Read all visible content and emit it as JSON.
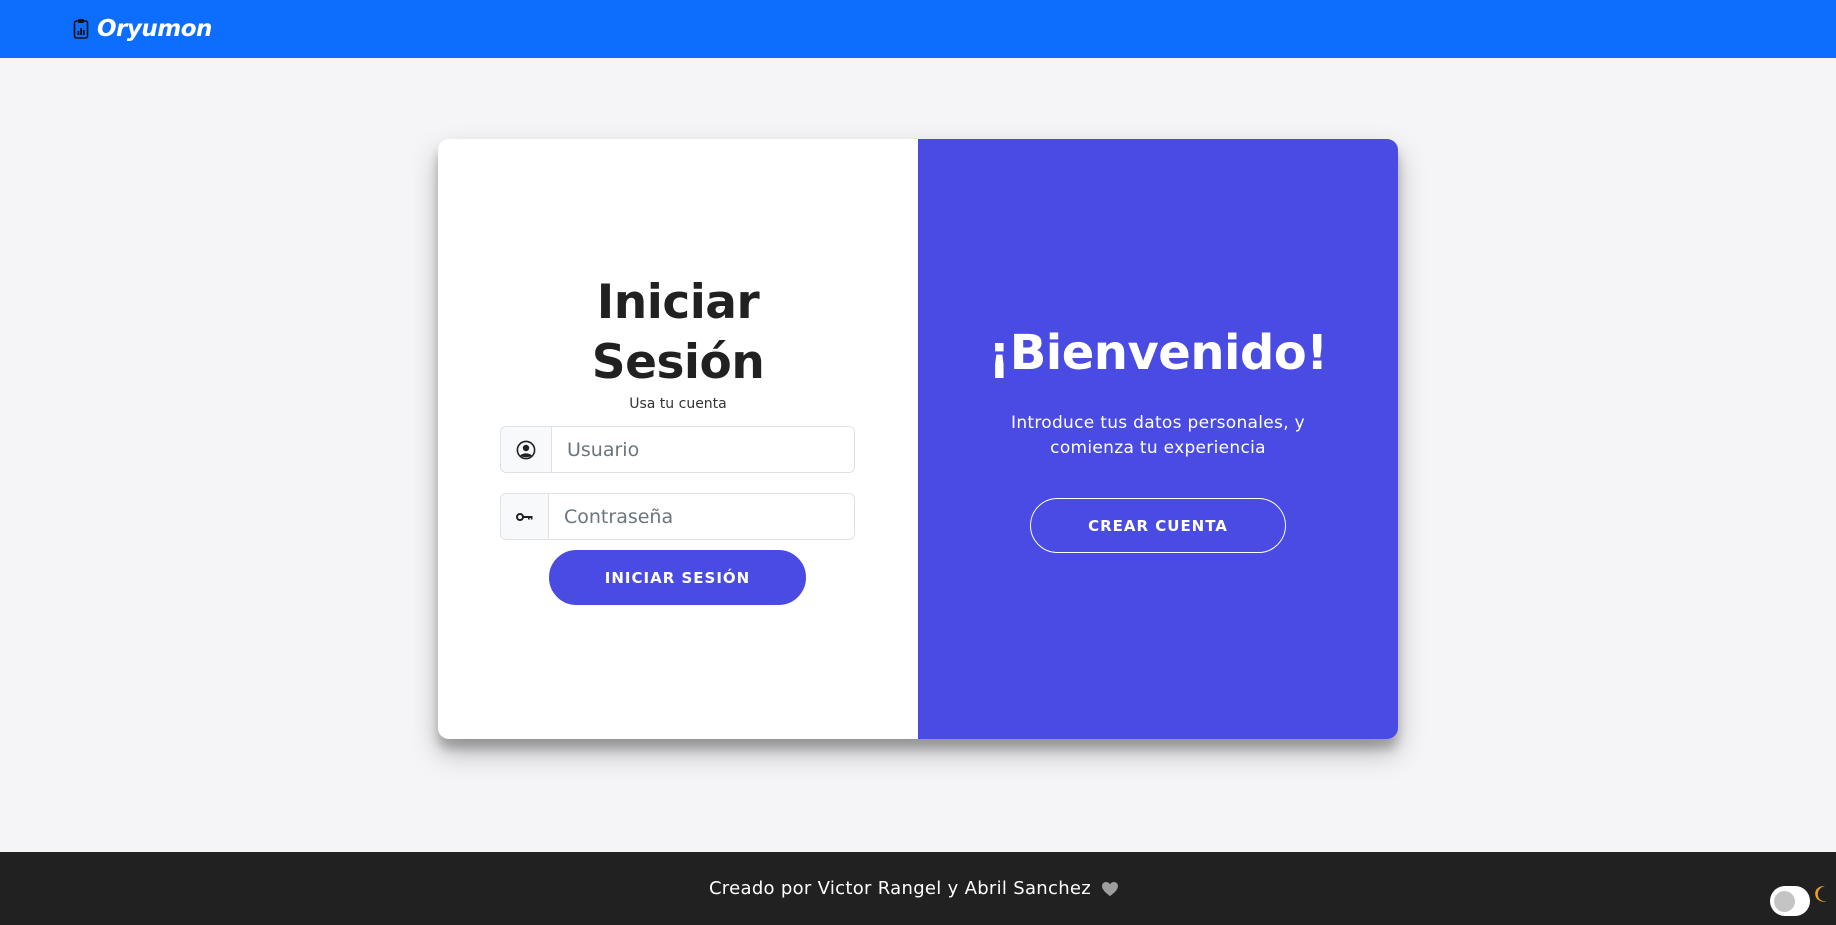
{
  "navbar": {
    "brand": "Oryumon",
    "brand_icon": "clipboard-chart-icon",
    "color": "#0d6efd"
  },
  "login": {
    "title": "Iniciar Sesión",
    "subtitle": "Usa tu cuenta",
    "username": {
      "placeholder": "Usuario",
      "value": "",
      "icon": "user-circle-icon"
    },
    "password": {
      "placeholder": "Contraseña",
      "value": "",
      "icon": "key-icon"
    },
    "submit_label": "INICIAR SESIÓN"
  },
  "welcome": {
    "title": "¡Bienvenido!",
    "text": "Introduce tus datos personales, y comienza tu experiencia",
    "create_label": "CREAR CUENTA",
    "color": "#4a4be3"
  },
  "footer": {
    "text": "Creado por Victor Rangel y Abril Sanchez",
    "heart_icon": "heart-icon"
  },
  "theme_toggle": {
    "icon": "moon-icon",
    "state": "light"
  }
}
